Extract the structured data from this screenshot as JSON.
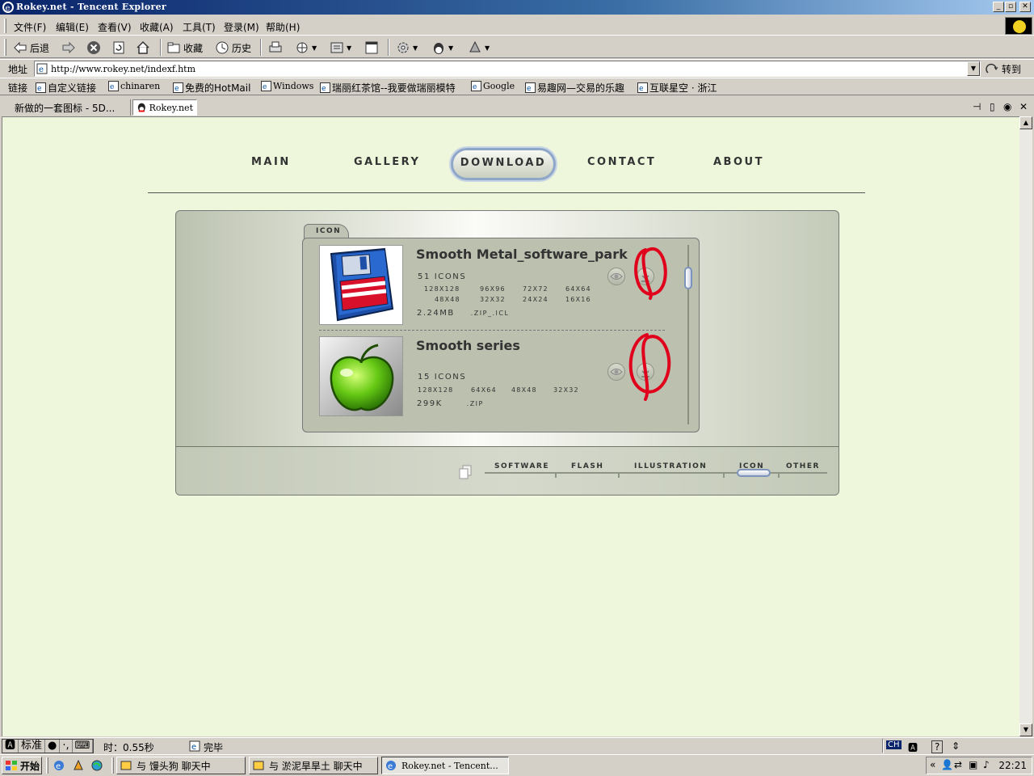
{
  "window": {
    "title": "Rokey.net - Tencent Explorer"
  },
  "menu": [
    "文件(F)",
    "编辑(E)",
    "查看(V)",
    "收藏(A)",
    "工具(T)",
    "登录(M)",
    "帮助(H)"
  ],
  "toolbar": {
    "back": "后退",
    "favorites": "收藏",
    "history": "历史"
  },
  "address": {
    "label": "地址",
    "url": "http://www.rokey.net/indexf.htm",
    "go": "转到"
  },
  "links": {
    "label": "链接",
    "items": [
      "自定义链接",
      "chinaren",
      "免费的HotMail",
      "Windows",
      "瑞丽红茶馆--我要做瑞丽模特",
      "Google",
      "易趣网—交易的乐趣",
      "互联星空 · 浙江"
    ]
  },
  "tabs": [
    "新做的一套图标 - 5D...",
    "Rokey.net"
  ],
  "site": {
    "nav": [
      "MAIN",
      "GALLERY",
      "DOWNLOAD",
      "CONTACT",
      "ABOUT"
    ],
    "active_nav": "DOWNLOAD",
    "folder_tab": "ICON",
    "items": [
      {
        "name": "Smooth Metal_software_park",
        "count": "51 ICONS",
        "sizes_row1": [
          "128X128",
          "96X96",
          "72X72",
          "64X64"
        ],
        "sizes_row2": [
          "48X48",
          "32X32",
          "24X24",
          "16X16"
        ],
        "filesize": "2.24MB",
        "format": ".ZIP_.ICL",
        "thumb_icon": "floppy-disk-icon"
      },
      {
        "name": "Smooth series",
        "count": "15 ICONS",
        "sizes_row1": [
          "128X128",
          "64X64",
          "48X48",
          "32X32"
        ],
        "filesize": "299K",
        "format": ".ZIP",
        "thumb_icon": "green-apple-icon"
      }
    ],
    "categories": [
      "SOFTWARE",
      "FLASH",
      "ILLUSTRATION",
      "ICON",
      "OTHER"
    ],
    "active_category": "ICON"
  },
  "status": {
    "ime": "标准",
    "time": "时：0.55秒",
    "done": "完毕",
    "ch": "CH"
  },
  "taskbar": {
    "start": "开始",
    "tasks": [
      "与 馒头狗 聊天中",
      "与 淤泥旱旱土 聊天中",
      "Rokey.net - Tencent..."
    ],
    "clock": "22:21"
  },
  "colors": {
    "page_bg": "#eef7dc",
    "accent": "#7d93bb",
    "annotation": "#e0001b"
  }
}
